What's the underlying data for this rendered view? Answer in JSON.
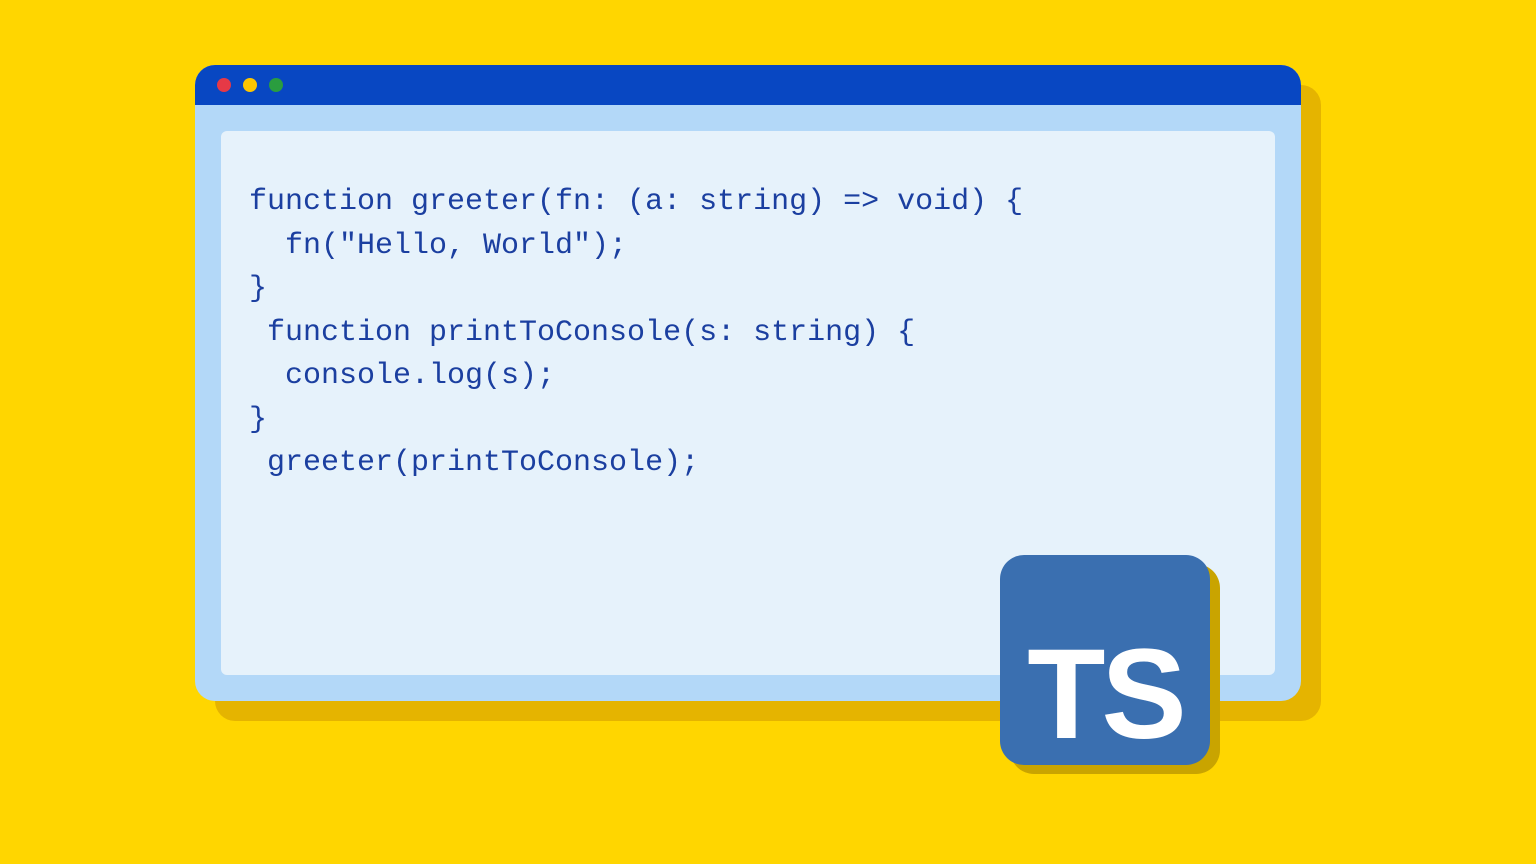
{
  "window": {
    "traffic_lights": [
      "close",
      "minimize",
      "zoom"
    ]
  },
  "code": {
    "lines": [
      "function greeter(fn: (a: string) => void) {",
      "  fn(\"Hello, World\");",
      "}",
      " function printToConsole(s: string) {",
      "  console.log(s);",
      "}",
      " greeter(printToConsole);"
    ]
  },
  "badge": {
    "label": "TS",
    "language": "TypeScript"
  },
  "colors": {
    "page_bg": "#FFD600",
    "titlebar": "#0847C2",
    "window_body": "#B3D8F8",
    "code_bg": "#E6F2FB",
    "code_fg": "#1B3FA0",
    "badge_bg": "#3A6FB0",
    "badge_fg": "#FFFFFF"
  }
}
